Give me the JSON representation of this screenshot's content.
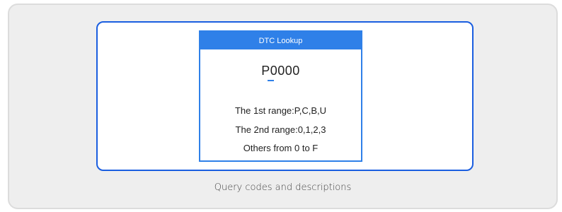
{
  "screen": {
    "title": "DTC Lookup",
    "code": "P0000",
    "lines": [
      "The 1st range:P,C,B,U",
      "The 2nd range:0,1,2,3",
      "Others from 0 to F"
    ]
  },
  "caption": "Query codes and descriptions",
  "colors": {
    "accent": "#2f80e8",
    "frame_border": "#1a5ee0",
    "card_background": "#eeeeee"
  }
}
